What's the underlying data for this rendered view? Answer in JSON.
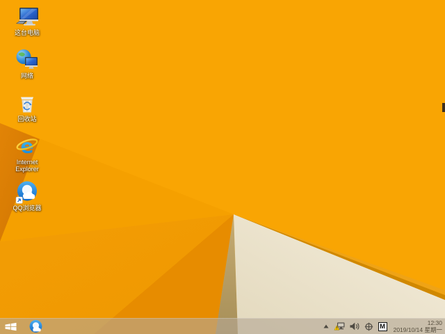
{
  "desktop": {
    "icons": [
      {
        "id": "this-pc",
        "label": "这台电脑"
      },
      {
        "id": "network",
        "label": "网络"
      },
      {
        "id": "recycle-bin",
        "label": "回收站"
      },
      {
        "id": "internet-explorer",
        "label": "Internet Explorer"
      },
      {
        "id": "qq-browser",
        "label": "QQ浏览器"
      }
    ]
  },
  "taskbar": {
    "tray": {
      "input_indicator": "M",
      "time": "12:30",
      "date": "2019/10/14 星期一"
    }
  },
  "colors": {
    "wallpaper_base": "#F9A503",
    "wallpaper_mid_fold": "#F19A02",
    "wallpaper_deep_fold": "#E78C00",
    "wallpaper_dark_wedge": "#D87B02",
    "wallpaper_shadow_tan": "#B89E64",
    "wallpaper_cream": "#F0E8D4",
    "wallpaper_edge_strip": "#D08800",
    "taskbar_tint": "rgba(180,168,150,0.62)"
  }
}
